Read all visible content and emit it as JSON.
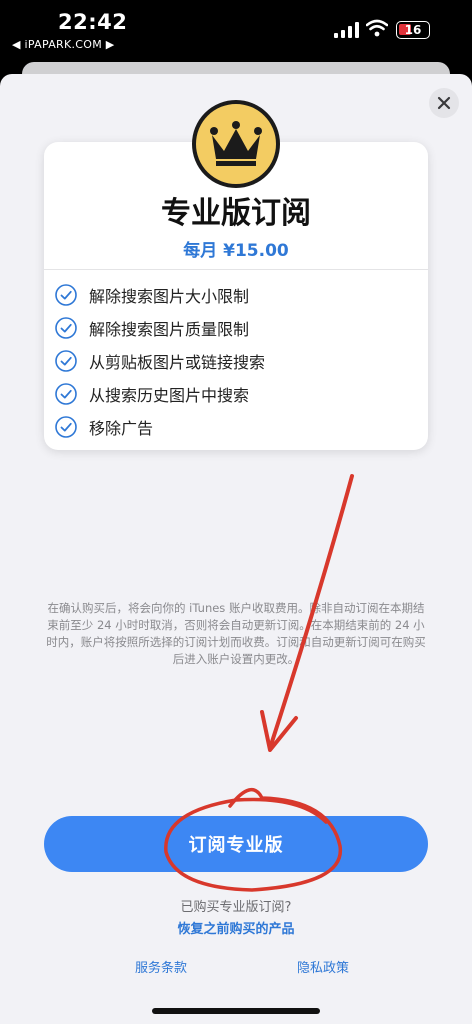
{
  "status_bar": {
    "time": "22:42",
    "back_link": "◀ iPAPARK.COM ▶",
    "battery": "16",
    "battery_color": "#e0323a"
  },
  "modal": {
    "close_icon": "close-icon",
    "crown_icon": "crown-icon",
    "title": "专业版订阅",
    "price": "每月 ¥15.00",
    "features": [
      "解除搜索图片大小限制",
      "解除搜索图片质量限制",
      "从剪贴板图片或链接搜索",
      "从搜索历史图片中搜索",
      "移除广告"
    ],
    "legal": "在确认购买后，将会向你的 iTunes 账户收取费用。除非自动订阅在本期结束前至少 24 小时时取消，否则将会自动更新订阅。在本期结束前的 24 小时内，账户将按照所选择的订阅计划而收费。订阅和自动更新订阅可在购买后进入账户设置内更改。",
    "subscribe_label": "订阅专业版",
    "already_purchased": "已购买专业版订阅?",
    "restore_label": "恢复之前购买的产品",
    "terms_label": "服务条款",
    "privacy_label": "隐私政策"
  },
  "colors": {
    "accent": "#3d87f3",
    "link": "#2f78d6",
    "crown_bg": "#f3cc62",
    "annotation": "#d8382c"
  }
}
